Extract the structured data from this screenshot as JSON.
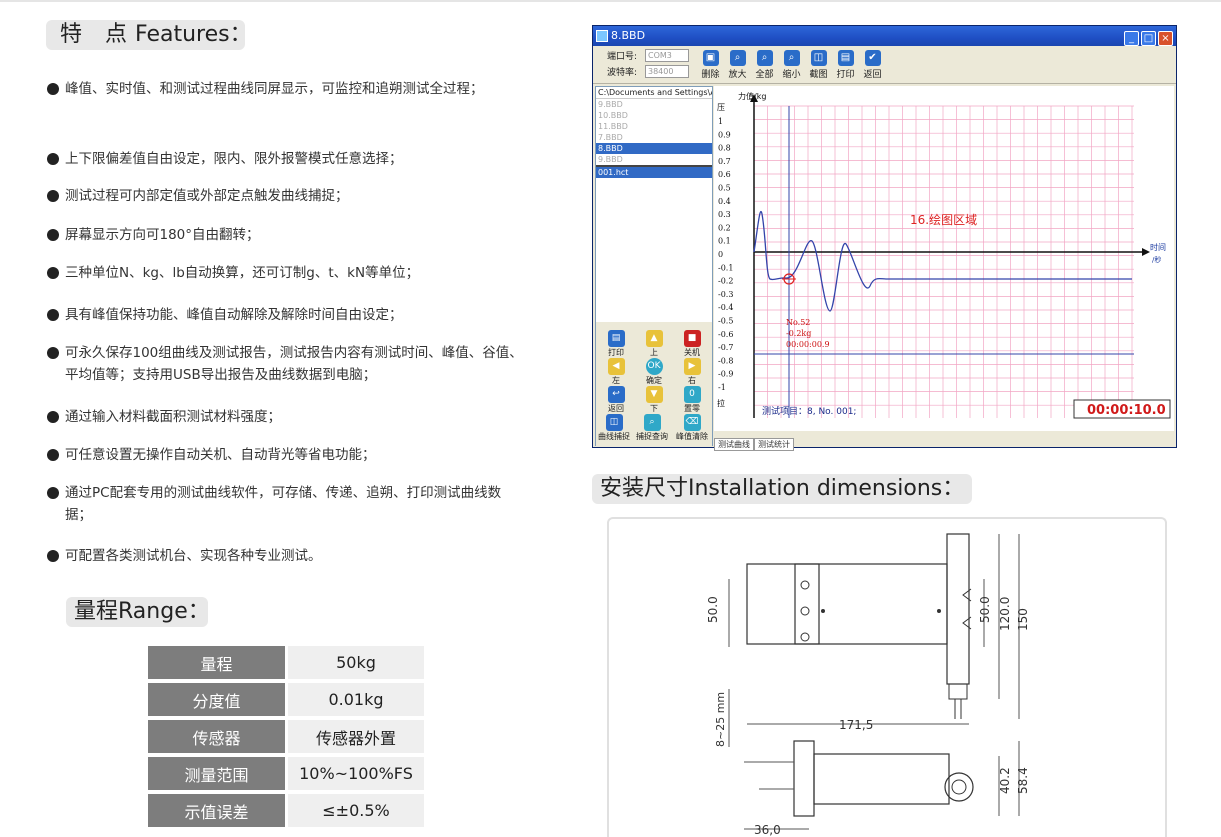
{
  "features": {
    "title_cn": "特 点",
    "title_en": "Features：",
    "items": [
      "峰值、实时值、和测试过程曲线同屏显示，可监控和追朔测试全过程；",
      "上下限偏差值自由设定，限内、限外报警模式任意选择；",
      "测试过程可内部定值或外部定点触发曲线捕捉；",
      "屏幕显示方向可180°自由翻转；",
      "三种单位N、kg、lb自动换算，还可订制g、t、kN等单位；",
      "具有峰值保持功能、峰值自动解除及解除时间自由设定；",
      "可永久保存100组曲线及测试报告，测试报告内容有测试时间、峰值、谷值、平均值等；支持用USB导出报告及曲线数据到电脑；",
      "通过输入材料截面积测试材料强度；",
      "可任意设置无操作自动关机、自动背光等省电功能；",
      "通过PC配套专用的测试曲线软件，可存储、传递、追朔、打印测试曲线数据；",
      "可配置各类测试机台、实现各种专业测试。"
    ]
  },
  "range": {
    "title": "量程Range：",
    "rows": [
      {
        "k": "量程",
        "v": "50kg"
      },
      {
        "k": "分度值",
        "v": "0.01kg"
      },
      {
        "k": "传感器",
        "v": "传感器外置"
      },
      {
        "k": "测量范围",
        "v": "10%~100%FS"
      },
      {
        "k": "示值误差",
        "v": "≤±0.5%"
      }
    ]
  },
  "software": {
    "window_title": "8.BBD",
    "port_label": "端口号:",
    "port_value": "COM3",
    "baud_label": "波特率:",
    "baud_value": "38400",
    "toolbar": [
      "删除",
      "放大",
      "全部",
      "缩小",
      "截图",
      "打印",
      "返回"
    ],
    "path": "C:\\Documents and Settings\\Adm",
    "files": [
      "9.BBD",
      "10.BBD",
      "11.BBD",
      "7.BBD",
      "8.BBD",
      "9.BBD"
    ],
    "selected_file_index": 4,
    "hct_file": "001.hct",
    "pad": [
      "打印",
      "上",
      "关机",
      "左",
      "确定",
      "右",
      "返回",
      "下",
      "置零"
    ],
    "bottom_buttons": [
      "曲线捕捉",
      "捕捉查询",
      "峰值清除"
    ],
    "y_label": "力值/kg",
    "y_top": "压",
    "y_bottom": "拉",
    "y_ticks": [
      "1",
      "0.9",
      "0.8",
      "0.7",
      "0.6",
      "0.5",
      "0.4",
      "0.3",
      "0.2",
      "0.1",
      "0",
      "-0.1",
      "-0.2",
      "-0.3",
      "-0.4",
      "-0.5",
      "-0.6",
      "-0.7",
      "-0.8",
      "-0.9",
      "-1"
    ],
    "x_label_1": "时间",
    "x_label_2": "/秒",
    "plot_area": "16.绘图区域",
    "point_no": "No.52",
    "point_value": "-0.2kg",
    "point_time": "00:00:00.9",
    "test_item": "测试项目：8, No. 001;",
    "timer": "00:00:10.0",
    "tabs": [
      "测试曲线",
      "测试统计"
    ]
  },
  "install": {
    "title": "安装尺寸Installation dimensions：",
    "dims": [
      "50.0",
      "50.0",
      "120.0",
      "150",
      "171,5",
      "8~25 mm",
      "40.2",
      "58.4",
      "36,0"
    ]
  }
}
